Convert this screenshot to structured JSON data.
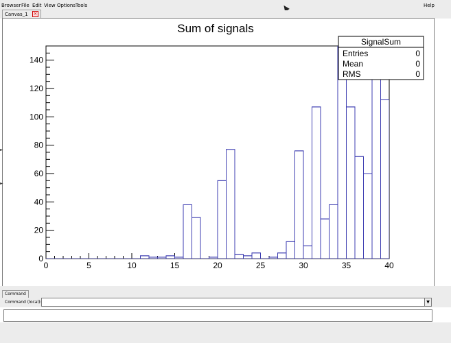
{
  "menubar": {
    "items": [
      {
        "label": "Browser"
      },
      {
        "label": "File"
      },
      {
        "label": "Edit"
      },
      {
        "label": "View"
      },
      {
        "label": "Options"
      },
      {
        "label": "Tools"
      }
    ],
    "help_label": "Help"
  },
  "tabs": {
    "canvas_tab_label": "Canvas_1"
  },
  "command": {
    "tab_label": "Command",
    "input_label": "Command (local):",
    "input_value": ""
  },
  "stats_box": {
    "title": "SignalSum",
    "rows": [
      {
        "label": "Entries",
        "value": "0"
      },
      {
        "label": "Mean",
        "value": "0"
      },
      {
        "label": "RMS",
        "value": "0"
      }
    ]
  },
  "colors": {
    "histogram_line": "#3b3bb0",
    "axis": "#000000"
  },
  "chart_data": {
    "type": "bar",
    "title": "Sum of signals",
    "xlabel": "",
    "ylabel": "",
    "xlim": [
      0,
      40
    ],
    "ylim": [
      0,
      150
    ],
    "bin_width": 1,
    "x_ticks": [
      0,
      5,
      10,
      15,
      20,
      25,
      30,
      35,
      40
    ],
    "y_ticks": [
      0,
      20,
      40,
      60,
      80,
      100,
      120,
      140
    ],
    "x": [
      0,
      1,
      2,
      3,
      4,
      5,
      6,
      7,
      8,
      9,
      10,
      11,
      12,
      13,
      14,
      15,
      16,
      17,
      18,
      19,
      20,
      21,
      22,
      23,
      24,
      25,
      26,
      27,
      28,
      29,
      30,
      31,
      32,
      33,
      34,
      35,
      36,
      37,
      38,
      39
    ],
    "values": [
      0,
      0,
      0,
      0,
      0,
      0,
      0,
      0,
      0,
      0,
      0,
      2,
      1,
      1,
      2,
      1,
      38,
      29,
      0,
      1,
      55,
      77,
      3,
      2,
      4,
      0,
      1,
      4,
      12,
      76,
      9,
      107,
      28,
      38,
      150,
      107,
      72,
      60,
      150,
      112
    ],
    "grid": false,
    "legend": "none"
  }
}
